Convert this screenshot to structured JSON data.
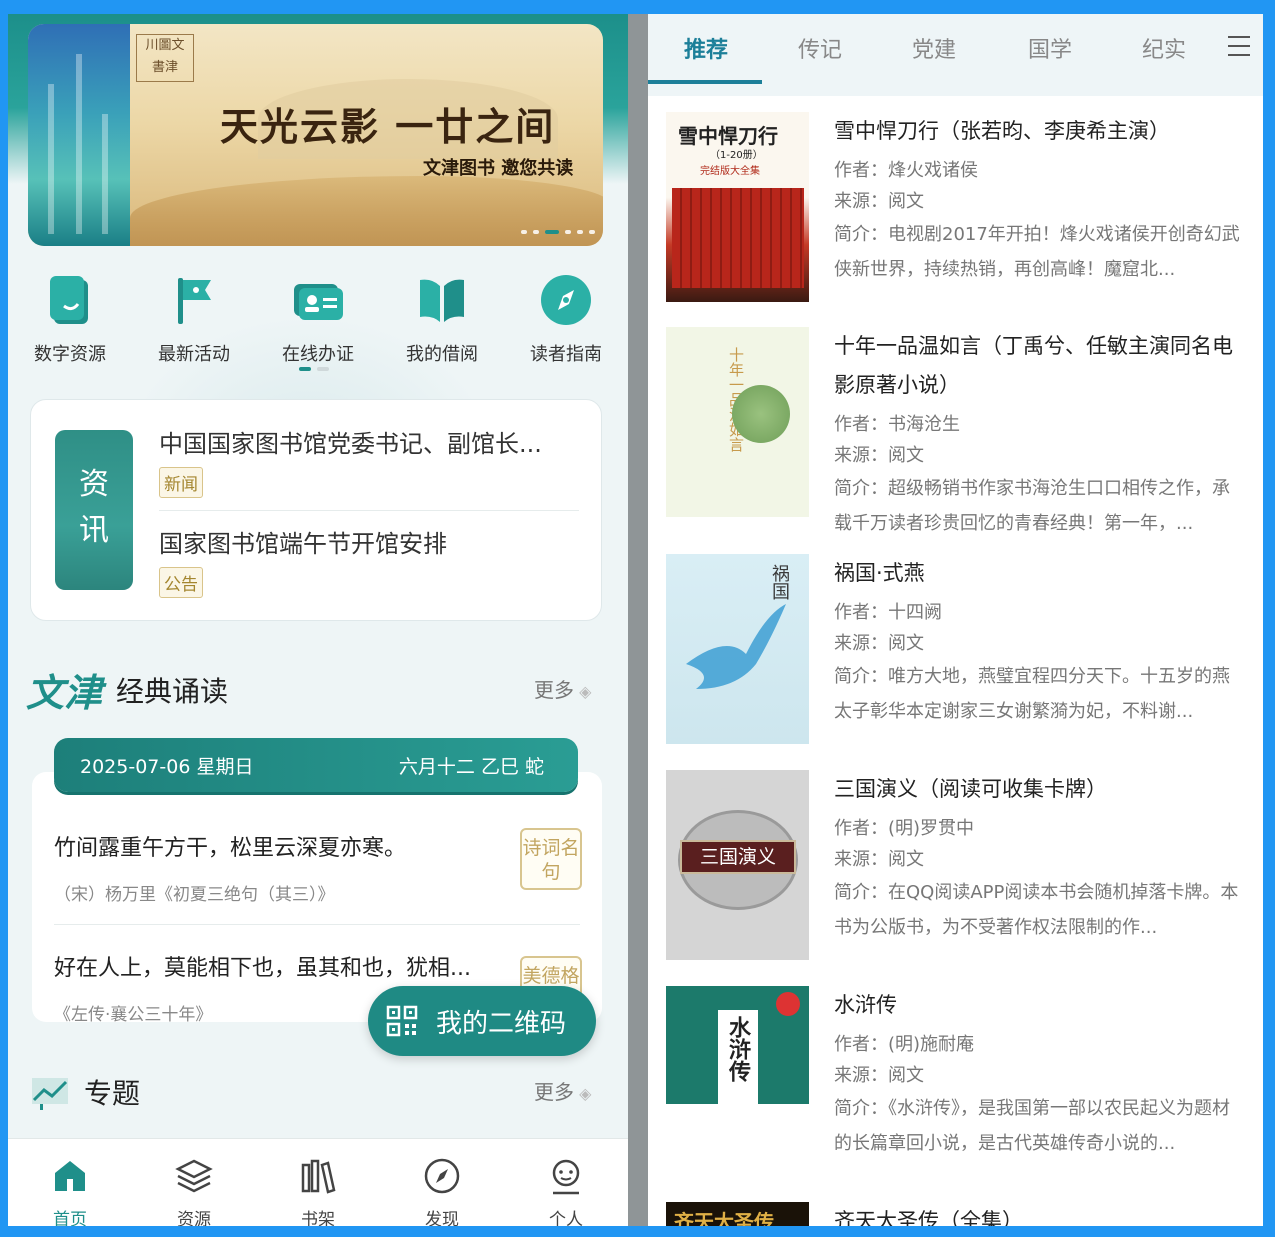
{
  "left": {
    "banner": {
      "stamp_lines": [
        "川",
        "圖",
        "文",
        "書",
        "津"
      ],
      "title": "天光云影 一廿之间",
      "subtitle": "文津图书 邀您共读"
    },
    "quick_actions": [
      {
        "label": "数字资源",
        "icon": "tablet-icon"
      },
      {
        "label": "最新活动",
        "icon": "flag-icon"
      },
      {
        "label": "在线办证",
        "icon": "id-card-icon"
      },
      {
        "label": "我的借阅",
        "icon": "open-book-icon"
      },
      {
        "label": "读者指南",
        "icon": "compass-icon"
      }
    ],
    "news": {
      "tag": "资讯",
      "items": [
        {
          "title": "中国国家图书馆党委书记、副馆长...",
          "badge": "新闻"
        },
        {
          "title": "国家图书馆端午节开馆安排",
          "badge": "公告"
        }
      ]
    },
    "classic": {
      "brand": "文津",
      "title": "经典诵读",
      "more": "更多",
      "date": "2025-07-06  星期日",
      "lunar": "六月十二  乙巳  蛇",
      "poems": [
        {
          "line": "竹间露重午方干，松里云深夏亦寒。",
          "source": "（宋）杨万里《初夏三绝句（其三）》",
          "stamp": "诗词名句"
        },
        {
          "line": "好在人上，莫能相下也，虽其和也，犹相...",
          "source": "《左传·襄公三十年》",
          "stamp": "美德格言"
        }
      ]
    },
    "qr_button": "我的二维码",
    "topic": {
      "title": "专题",
      "more": "更多"
    },
    "tabbar": [
      {
        "label": "首页",
        "icon": "home-icon",
        "active": true
      },
      {
        "label": "资源",
        "icon": "layers-icon",
        "active": false
      },
      {
        "label": "书架",
        "icon": "bookshelf-icon",
        "active": false
      },
      {
        "label": "发现",
        "icon": "compass-icon",
        "active": false
      },
      {
        "label": "个人",
        "icon": "user-icon",
        "active": false
      }
    ]
  },
  "right": {
    "tabs": [
      "推荐",
      "传记",
      "党建",
      "国学",
      "纪实"
    ],
    "active_tab": "推荐",
    "books": [
      {
        "title": "雪中悍刀行（张若昀、李庚希主演）",
        "author": "作者：烽火戏诸侯",
        "source": "来源：阅文",
        "desc": "简介：电视剧2017年开拍！烽火戏诸侯开创奇幻武侠新世界，持续热销，再创高峰！魔窟北...",
        "cover_text": "雪中悍刀行",
        "cover_sub": "（1-20册）",
        "cover_note": "完结版大全集"
      },
      {
        "title": "十年一品温如言（丁禹兮、任敏主演同名电影原著小说）",
        "author": "作者：书海沧生",
        "source": "来源：阅文",
        "desc": "简介：超级畅销书作家书海沧生口口相传之作，承载千万读者珍贵回忆的青春经典！第一年，...",
        "cover_text": "十年一品温如言"
      },
      {
        "title": "祸国·式燕",
        "author": "作者：十四阙",
        "source": "来源：阅文",
        "desc": "简介：唯方大地，燕璧宜程四分天下。十五岁的燕太子彰华本定谢家三女谢繁漪为妃，不料谢...",
        "cover_text": "祸国"
      },
      {
        "title": "三国演义（阅读可收集卡牌）",
        "author": "作者：(明)罗贯中",
        "source": "来源：阅文",
        "desc": "简介：在QQ阅读APP阅读本书会随机掉落卡牌。本书为公版书，为不受著作权法限制的作...",
        "cover_text": "三国演义"
      },
      {
        "title": "水浒传",
        "author": "作者：(明)施耐庵",
        "source": "来源：阅文",
        "desc": "简介：《水浒传》，是我国第一部以农民起义为题材的长篇章回小说，是古代英雄传奇小说的...",
        "cover_text": "水浒传"
      },
      {
        "title": "齐天大圣传（全集）",
        "cover_text": "齐天大圣传"
      }
    ]
  },
  "colors": {
    "brand_teal": "#1f8f8a",
    "tab_blue": "#1c7f99",
    "frame_blue": "#2196f3"
  }
}
